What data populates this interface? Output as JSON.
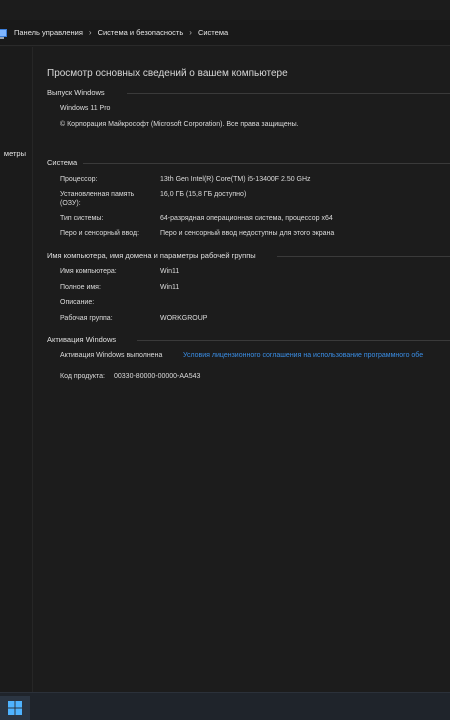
{
  "breadcrumb": {
    "items": [
      "Панель управления",
      "Система и безопасность",
      "Система"
    ],
    "separator": "›"
  },
  "leftnav": {
    "visible_label": "метры"
  },
  "page": {
    "title": "Просмотр основных сведений о вашем компьютере"
  },
  "edition": {
    "header": "Выпуск Windows",
    "name": "Windows 11 Pro",
    "copyright": "© Корпорация Майкрософт (Microsoft Corporation). Все права защищены."
  },
  "system": {
    "header": "Система",
    "rows": [
      {
        "label": "Процессор:",
        "value": "13th Gen Intel(R) Core(TM) i5-13400F   2.50 GHz"
      },
      {
        "label": "Установленная память",
        "label2": "(ОЗУ):",
        "value": "16,0 ГБ (15,8 ГБ доступно)"
      },
      {
        "label": "Тип системы:",
        "value": "64-разрядная операционная система, процессор x64"
      },
      {
        "label": "Перо и сенсорный ввод:",
        "value": "Перо и сенсорный ввод недоступны для этого экрана"
      }
    ]
  },
  "computer_name": {
    "header": "Имя компьютера, имя домена и параметры рабочей группы",
    "rows": [
      {
        "label": "Имя компьютера:",
        "value": "Win11"
      },
      {
        "label": "Полное имя:",
        "value": "Win11"
      },
      {
        "label": "Описание:",
        "value": ""
      },
      {
        "label": "Рабочая группа:",
        "value": "WORKGROUP"
      }
    ]
  },
  "activation": {
    "header": "Активация Windows",
    "status": "Активация Windows выполнена",
    "license_link": "Условия лицензионного соглашения на использование программного обе",
    "product_key_label": "Код продукта:",
    "product_key": "00330-80000-00000-AA543"
  },
  "colors": {
    "background": "#1c1c1c",
    "text": "#d8d8d8",
    "link": "#3a8ee6",
    "taskbar": "#1f242b"
  },
  "icons": {
    "control_panel": "control-panel-icon",
    "start": "windows-start-icon"
  }
}
